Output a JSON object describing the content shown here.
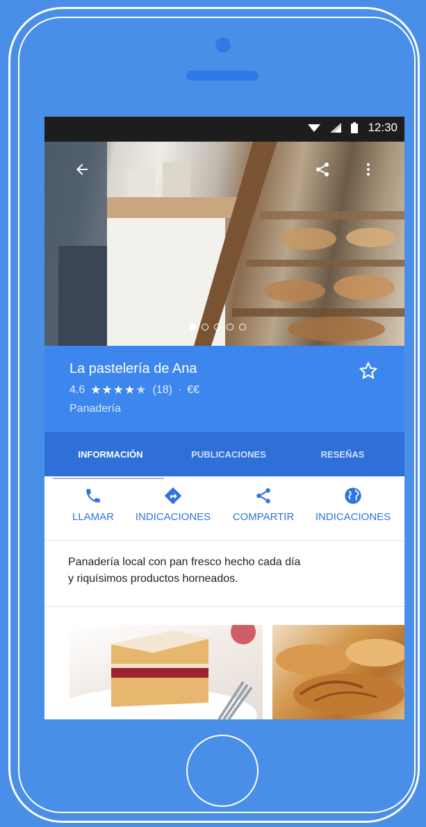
{
  "status_bar": {
    "time": "12:30",
    "icons": [
      "wifi-icon",
      "signal-icon",
      "battery-icon"
    ]
  },
  "hero": {
    "back_icon": "arrow-left-icon",
    "share_icon": "share-icon",
    "more_icon": "more-vert-icon",
    "carousel": {
      "count": 5,
      "active": 1
    }
  },
  "place": {
    "name": "La pastelería de Ana",
    "rating": "4.6",
    "stars_value": 4.5,
    "reviews": "(18)",
    "separator": "·",
    "price": "€€",
    "category": "Panadería",
    "save_icon": "star-outline-icon"
  },
  "tabs": [
    {
      "label": "INFORMACIÓN",
      "active": true
    },
    {
      "label": "PUBLICACIONES",
      "active": false
    },
    {
      "label": "RESEÑAS",
      "active": false
    }
  ],
  "actions": [
    {
      "label": "LLAMAR",
      "icon": "phone-icon"
    },
    {
      "label": "INDICACIONES",
      "icon": "directions-icon"
    },
    {
      "label": "COMPARTIR",
      "icon": "share-icon"
    },
    {
      "label": "INDICACIONES",
      "icon": "globe-icon"
    }
  ],
  "description": {
    "line1": "Panadería local con pan fresco hecho cada día",
    "line2": "y riquísimos productos horneados."
  },
  "colors": {
    "background": "#4a8fe7",
    "header": "#3d86ee",
    "tabs": "#2f6fd8",
    "accent": "#2f74e0"
  }
}
